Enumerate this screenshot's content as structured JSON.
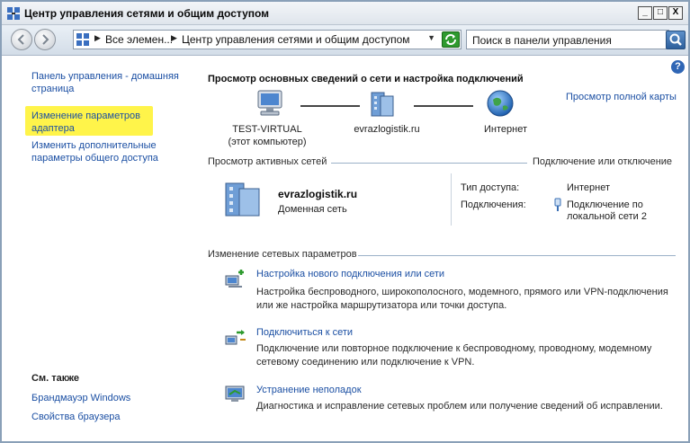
{
  "window": {
    "title": "Центр управления сетями и общим доступом"
  },
  "titlebar_buttons": {
    "minimize": "_",
    "maximize": "□",
    "close": "X"
  },
  "address": {
    "crumbs": [
      "Все элемен...",
      "Центр управления сетями и общим доступом"
    ]
  },
  "search": {
    "placeholder": "Поиск в панели управления"
  },
  "help": {
    "label": "?"
  },
  "sidebar": {
    "home_link_line1": "Панель управления - домашняя",
    "home_link_line2": "страница",
    "adapter_link_line1": "Изменение параметров",
    "adapter_link_line2": "адаптера",
    "sharing_link_line1": "Изменить дополнительные",
    "sharing_link_line2": "параметры общего доступа",
    "see_also_title": "См. также",
    "see_also": [
      "Брандмауэр Windows",
      "Свойства браузера"
    ]
  },
  "main": {
    "title": "Просмотр основных сведений о сети и настройка подключений",
    "full_map_link": "Просмотр полной карты",
    "nodes": [
      {
        "label_line1": "TEST-VIRTUAL",
        "label_line2": "(этот компьютер)"
      },
      {
        "label_line1": "evrazlogistik.ru",
        "label_line2": ""
      },
      {
        "label_line1": "Интернет",
        "label_line2": ""
      }
    ],
    "active_networks_header": "Просмотр активных сетей",
    "connect_disconnect_link": "Подключение или отключение",
    "active_network": {
      "name": "evrazlogistik.ru",
      "type": "Доменная сеть",
      "access_type_label": "Тип доступа:",
      "access_type_value": "Интернет",
      "connections_label": "Подключения:",
      "connections_value_line1": "Подключение по",
      "connections_value_line2": "локальной сети 2"
    },
    "change_settings_header": "Изменение сетевых параметров",
    "tasks": [
      {
        "link": "Настройка нового подключения или сети",
        "desc_line1": "Настройка беспроводного, широкополосного, модемного, прямого или VPN-подключения",
        "desc_line2": "или же настройка маршрутизатора или точки доступа."
      },
      {
        "link": "Подключиться к сети",
        "desc_line1": "Подключение или повторное подключение к беспроводному, проводному, модемному",
        "desc_line2": "сетевому соединению или подключение к VPN."
      },
      {
        "link": "Устранение неполадок",
        "desc_line1": "Диагностика и исправление сетевых проблем или получение сведений об исправлении.",
        "desc_line2": ""
      }
    ]
  },
  "icons": {
    "app": "network-center-icon",
    "back": "back-arrow-icon",
    "forward": "forward-arrow-icon",
    "refresh": "refresh-icon",
    "search": "search-icon",
    "computer": "computer-icon",
    "domain": "domain-network-icon",
    "internet": "globe-icon"
  },
  "colors": {
    "link": "#1b4fa3",
    "highlight": "#fff44a",
    "accent": "#2f66b5"
  }
}
